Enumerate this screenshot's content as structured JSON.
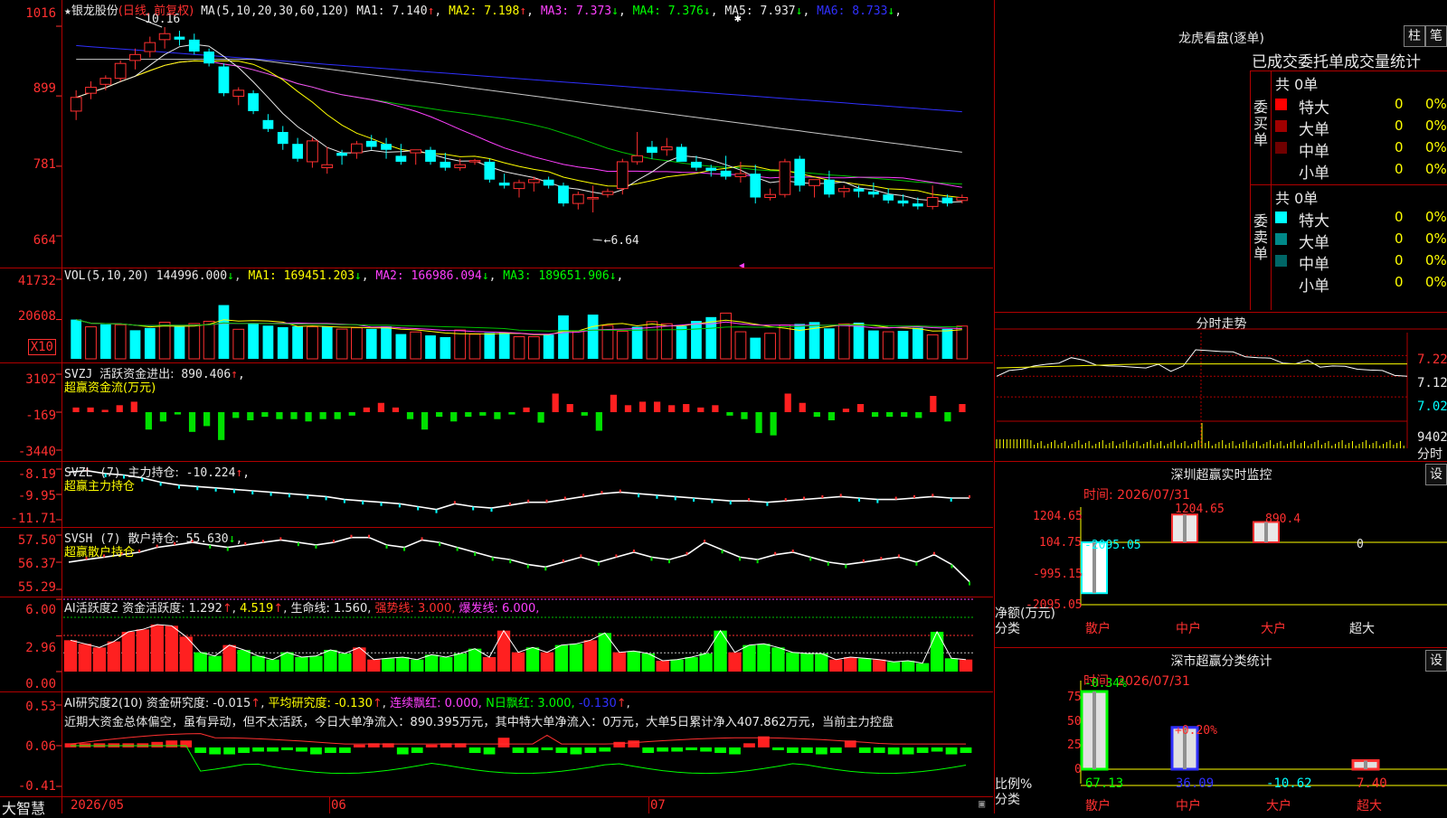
{
  "app": {
    "brand": "大智慧"
  },
  "kline": {
    "star": "★",
    "stock": "银龙股份",
    "mode": "(日线, 前复权)",
    "ma_label": "MA(5,10,20,30,60,120)",
    "ma": [
      {
        "name": "MA1:",
        "value": "7.140",
        "arrow": "↑",
        "color": "#e8e8e8"
      },
      {
        "name": "MA2:",
        "value": "7.198",
        "arrow": "↑",
        "color": "#ffff00"
      },
      {
        "name": "MA3:",
        "value": "7.373",
        "arrow": "↓",
        "color": "#ff40ff"
      },
      {
        "name": "MA4:",
        "value": "7.376",
        "arrow": "↓",
        "color": "#00ff00"
      },
      {
        "name": "MA5:",
        "value": "7.937",
        "arrow": "↓",
        "color": "#e8e8e8"
      },
      {
        "name": "MA6:",
        "value": "8.733",
        "arrow": "↓",
        "color": "#3030ff"
      }
    ],
    "yticks": [
      "1016",
      "899",
      "781",
      "664"
    ],
    "high_label": "10.16",
    "low_label": "6.64"
  },
  "volume": {
    "label": "VOL(5,10,20)",
    "value": "144996.000",
    "ma": [
      {
        "name": "MA1:",
        "value": "169451.203",
        "arrow": "↓",
        "color": "#ffff00"
      },
      {
        "name": "MA2:",
        "value": "166986.094",
        "arrow": "↓",
        "color": "#ff40ff"
      },
      {
        "name": "MA3:",
        "value": "189651.906",
        "arrow": "↓",
        "color": "#00ff00"
      }
    ],
    "yticks": [
      "41732",
      "20608"
    ],
    "unit": "X10"
  },
  "svzj": {
    "label": "SVZJ",
    "name": "活跃资金进出:",
    "value": "890.406",
    "arrow": "↑",
    "sub": "超赢资金流(万元)",
    "yticks": [
      "3102",
      "-169",
      "-3440"
    ]
  },
  "svzl": {
    "label": "SVZL (7)",
    "name": "主力持仓:",
    "value": "-10.224",
    "arrow": "↑",
    "sub": "超赢主力持仓",
    "yticks": [
      "-8.19",
      "-9.95",
      "-11.71"
    ]
  },
  "svsh": {
    "label": "SVSH (7)",
    "name": "散户持仓:",
    "value": "55.630",
    "arrow": "↓",
    "sub": "超赢散户持仓",
    "yticks": [
      "57.50",
      "56.37",
      "55.29"
    ]
  },
  "ai_active": {
    "label": "AI活跃度2",
    "name": "资金活跃度:",
    "value": "1.292",
    "v2": "4.519",
    "life": "生命线: 1.560,",
    "strong": "强势线: 3.000,",
    "burst": "爆发线: 6.000,",
    "yticks": [
      "6.00",
      "2.96",
      "0.00"
    ]
  },
  "ai_research": {
    "label": "AI研究度2(10)",
    "name": "资金研究度:",
    "value": "-0.015",
    "avg": "平均研究度: -0.130",
    "streak": "连续飘红: 0.000,",
    "nday": "N日飘红: 3.000,",
    "last": "-0.130",
    "commentary": "近期大资金总体偏空，虽有异动，但不太活跃，今日大单净流入：890.395万元，其中特大单净流入：0万元，大单5日累计净入407.862万元，当前主力控盘",
    "yticks": [
      "0.53",
      "0.06",
      "-0.41"
    ]
  },
  "xaxis": [
    "2026/05",
    "06",
    "07"
  ],
  "lhb": {
    "title": "龙虎看盘(逐单)",
    "tab1": "柱",
    "tab2": "笔",
    "headers": [
      "已成交",
      "委托单",
      "成交量统计"
    ],
    "buy_group": {
      "label": "委买单",
      "total": "共 0单"
    },
    "sell_group": {
      "label": "委卖单",
      "total": "共 0单"
    },
    "buy_rows": [
      {
        "name": "特大",
        "count": "0",
        "pct": "0%",
        "color": "#ff0000"
      },
      {
        "name": "大单",
        "count": "0",
        "pct": "0%",
        "color": "#a00000"
      },
      {
        "name": "中单",
        "count": "0",
        "pct": "0%",
        "color": "#700000"
      },
      {
        "name": "小单",
        "count": "0",
        "pct": "0%",
        "color": "#000000"
      }
    ],
    "sell_rows": [
      {
        "name": "特大",
        "count": "0",
        "pct": "0%",
        "color": "#00ffff"
      },
      {
        "name": "大单",
        "count": "0",
        "pct": "0%",
        "color": "#008888"
      },
      {
        "name": "中单",
        "count": "0",
        "pct": "0%",
        "color": "#006666"
      },
      {
        "name": "小单",
        "count": "0",
        "pct": "0%",
        "color": "#000000"
      }
    ]
  },
  "intraday": {
    "title": "分时走势",
    "yticks": [
      "7.22",
      "7.12",
      "7.02"
    ],
    "vol_label": "9402",
    "vol_unit": "分时"
  },
  "monitor": {
    "title": "深圳超赢实时监控",
    "btn": "设",
    "time": "时间: 2026/07/31",
    "yticks": [
      "1204.65",
      "104.75",
      "-995.15",
      "-2095.05"
    ],
    "ylabel": "净额(万元)",
    "xlabel": "分类",
    "categories": [
      "散户",
      "中户",
      "大户",
      "超大"
    ],
    "values": [
      -2095.05,
      1204.65,
      890.4,
      0
    ],
    "value_labels": [
      "-2095.05",
      "1204.65",
      "890.4",
      "0"
    ]
  },
  "classify": {
    "title": "深市超赢分类统计",
    "btn": "设",
    "time": "时间: 2026/07/31",
    "yticks": [
      "75",
      "50",
      "25",
      "0"
    ],
    "ylabel": "比例%",
    "xlabel": "分类",
    "categories": [
      "散户",
      "中户",
      "大户",
      "超大"
    ],
    "values": [
      67.13,
      36.09,
      -10.62,
      7.4
    ],
    "value_labels": [
      "67.13",
      "36.09",
      "-10.62",
      "7.40"
    ],
    "change_labels": [
      "-0.34%",
      "+0.20%"
    ]
  },
  "chart_data": [
    {
      "type": "candlestick",
      "title": "银龙股份 (日线, 前复权)",
      "ylim": [
        6.64,
        10.16
      ],
      "x_labels": [
        "2026/05",
        "06",
        "07"
      ],
      "candles": [
        [
          8.75,
          9.1,
          8.6,
          8.98
        ],
        [
          9.05,
          9.25,
          8.95,
          9.15
        ],
        [
          9.2,
          9.35,
          9.1,
          9.3
        ],
        [
          9.3,
          9.6,
          9.25,
          9.55
        ],
        [
          9.6,
          9.8,
          9.45,
          9.7
        ],
        [
          9.75,
          10.0,
          9.65,
          9.9
        ],
        [
          9.95,
          10.16,
          9.8,
          10.05
        ],
        [
          10.0,
          10.1,
          9.85,
          9.95
        ],
        [
          9.95,
          10.05,
          9.7,
          9.75
        ],
        [
          9.75,
          9.8,
          9.5,
          9.55
        ],
        [
          9.5,
          9.55,
          9.0,
          9.05
        ],
        [
          9.0,
          9.15,
          8.85,
          9.1
        ],
        [
          9.05,
          9.1,
          8.7,
          8.75
        ],
        [
          8.6,
          8.7,
          8.4,
          8.45
        ],
        [
          8.4,
          8.5,
          8.1,
          8.2
        ],
        [
          8.2,
          8.3,
          7.9,
          7.95
        ],
        [
          7.9,
          8.3,
          7.8,
          8.25
        ],
        [
          7.8,
          8.15,
          7.7,
          7.85
        ],
        [
          8.05,
          8.1,
          7.85,
          8.0
        ],
        [
          8.05,
          8.25,
          7.95,
          8.2
        ],
        [
          8.25,
          8.35,
          8.1,
          8.15
        ],
        [
          8.2,
          8.3,
          7.95,
          8.1
        ],
        [
          8.0,
          8.2,
          7.85,
          7.9
        ],
        [
          8.05,
          8.1,
          7.85,
          8.1
        ],
        [
          8.1,
          8.15,
          7.85,
          7.9
        ],
        [
          7.9,
          8.05,
          7.75,
          7.8
        ],
        [
          7.8,
          7.95,
          7.75,
          7.85
        ],
        [
          7.9,
          7.95,
          7.85,
          7.92
        ],
        [
          7.9,
          7.95,
          7.55,
          7.6
        ],
        [
          7.55,
          7.7,
          7.45,
          7.5
        ],
        [
          7.45,
          7.6,
          7.3,
          7.55
        ],
        [
          7.55,
          7.65,
          7.4,
          7.6
        ],
        [
          7.6,
          7.65,
          7.45,
          7.5
        ],
        [
          7.5,
          7.55,
          7.15,
          7.2
        ],
        [
          7.2,
          7.4,
          7.1,
          7.35
        ],
        [
          7.3,
          7.5,
          7.05,
          7.3
        ],
        [
          7.35,
          7.45,
          7.3,
          7.4
        ],
        [
          7.45,
          7.95,
          7.35,
          7.9
        ],
        [
          7.9,
          8.4,
          7.85,
          8.0
        ],
        [
          8.15,
          8.25,
          7.95,
          8.05
        ],
        [
          8.1,
          8.3,
          8.0,
          8.15
        ],
        [
          8.15,
          8.2,
          7.95,
          7.9
        ],
        [
          7.9,
          8.0,
          7.75,
          7.8
        ],
        [
          7.8,
          7.85,
          7.65,
          7.75
        ],
        [
          7.75,
          8.0,
          7.6,
          7.65
        ],
        [
          7.65,
          7.9,
          7.55,
          7.7
        ],
        [
          7.7,
          7.85,
          7.2,
          7.3
        ],
        [
          7.3,
          7.45,
          7.25,
          7.35
        ],
        [
          7.35,
          7.95,
          7.3,
          7.9
        ],
        [
          7.95,
          8.0,
          7.4,
          7.5
        ],
        [
          7.5,
          7.55,
          7.3,
          7.6
        ],
        [
          7.6,
          7.75,
          7.3,
          7.35
        ],
        [
          7.4,
          7.5,
          7.3,
          7.45
        ],
        [
          7.45,
          7.5,
          7.3,
          7.4
        ],
        [
          7.4,
          7.55,
          7.3,
          7.35
        ],
        [
          7.35,
          7.45,
          7.2,
          7.25
        ],
        [
          7.25,
          7.35,
          7.15,
          7.2
        ],
        [
          7.2,
          7.3,
          7.1,
          7.15
        ],
        [
          7.15,
          7.5,
          7.1,
          7.3
        ],
        [
          7.3,
          7.35,
          7.15,
          7.2
        ],
        [
          7.25,
          7.35,
          7.2,
          7.3
        ]
      ]
    },
    {
      "type": "bar",
      "title": "VOL(5,10,20)",
      "ylim": [
        0,
        41732
      ],
      "values": [
        20600,
        16800,
        18100,
        17900,
        15000,
        16200,
        19200,
        17000,
        18500,
        19700,
        28200,
        15500,
        18500,
        17400,
        16600,
        17100,
        16800,
        16900,
        15600,
        16300,
        15700,
        17000,
        13000,
        14100,
        12300,
        11400,
        15100,
        12900,
        13600,
        13700,
        11600,
        11600,
        12700,
        22800,
        14600,
        23200,
        17500,
        14500,
        16800,
        19500,
        18400,
        17200,
        19900,
        21900,
        24000,
        14200,
        11100,
        13400,
        17700,
        18300,
        19300,
        16000,
        18300,
        19000,
        14900,
        14200,
        14700,
        16300,
        12600,
        15700,
        17200
      ],
      "up": [
        false,
        true,
        false,
        true,
        false,
        false,
        true,
        false,
        true,
        true,
        false,
        true,
        false,
        false,
        false,
        false,
        true,
        false,
        true,
        true,
        false,
        false,
        false,
        true,
        false,
        false,
        true,
        true,
        false,
        false,
        true,
        true,
        false,
        false,
        true,
        false,
        true,
        true,
        false,
        true,
        true,
        false,
        false,
        false,
        true,
        true,
        false,
        true,
        true,
        false,
        false,
        false,
        true,
        false,
        false,
        true,
        false,
        false,
        true,
        false,
        true
      ]
    },
    {
      "type": "bar",
      "title": "SVZJ 活跃资金进出",
      "ylim": [
        -3440,
        3102
      ],
      "values": [
        400,
        400,
        200,
        600,
        900,
        -1500,
        -800,
        -200,
        -1700,
        -1200,
        -2400,
        -500,
        -700,
        -400,
        -600,
        -600,
        -800,
        -600,
        -600,
        -300,
        400,
        800,
        400,
        -600,
        -1500,
        -400,
        -800,
        -400,
        -300,
        -600,
        -200,
        400,
        -900,
        1600,
        700,
        -300,
        -1600,
        1500,
        600,
        900,
        900,
        600,
        700,
        400,
        600,
        -300,
        -600,
        -1800,
        -2000,
        1600,
        800,
        -400,
        -700,
        300,
        700,
        -400,
        -400,
        -400,
        -500,
        1400,
        -800,
        700
      ]
    },
    {
      "type": "line",
      "title": "SVZL 主力持仓",
      "ylim": [
        -11.71,
        -8.19
      ],
      "values": [
        -8.4,
        -8.3,
        -8.5,
        -8.6,
        -8.8,
        -9.1,
        -9.3,
        -9.4,
        -9.5,
        -9.6,
        -9.7,
        -9.8,
        -9.9,
        -10.0,
        -10.1,
        -10.3,
        -10.4,
        -10.5,
        -10.6,
        -10.8,
        -11.0,
        -10.6,
        -10.8,
        -10.9,
        -10.7,
        -10.5,
        -10.5,
        -10.3,
        -10.1,
        -9.9,
        -9.8,
        -9.9,
        -10.0,
        -10.1,
        -10.2,
        -10.3,
        -10.4,
        -10.4,
        -10.5,
        -10.4,
        -10.3,
        -10.2,
        -10.1,
        -10.2,
        -10.3,
        -10.3,
        -10.2,
        -10.1,
        -10.2,
        -10.2
      ]
    },
    {
      "type": "line",
      "title": "SVSH 散户持仓",
      "ylim": [
        55.29,
        57.5
      ],
      "values": [
        56.4,
        56.5,
        56.6,
        56.7,
        56.8,
        57.0,
        57.1,
        57.2,
        57.1,
        57.0,
        57.1,
        57.2,
        57.3,
        57.2,
        57.1,
        57.2,
        57.4,
        57.4,
        57.1,
        57.0,
        57.3,
        57.2,
        57.0,
        56.8,
        56.6,
        56.5,
        56.3,
        56.2,
        56.4,
        56.6,
        56.4,
        56.6,
        56.8,
        56.6,
        56.5,
        56.7,
        57.2,
        56.9,
        56.6,
        56.5,
        56.7,
        56.8,
        56.6,
        56.4,
        56.3,
        56.4,
        56.5,
        56.6,
        56.4,
        56.7,
        56.3,
        55.6
      ]
    },
    {
      "type": "bar",
      "title": "AI活跃度2 资金活跃度",
      "ylim": [
        0,
        6
      ],
      "values": [
        2.6,
        2.3,
        2.0,
        2.5,
        3.3,
        3.5,
        3.9,
        3.8,
        2.9,
        1.6,
        1.3,
        2.2,
        1.8,
        1.3,
        1.0,
        1.6,
        1.2,
        1.3,
        1.8,
        1.5,
        2.0,
        1.0,
        1.1,
        1.2,
        1.0,
        1.4,
        1.2,
        1.5,
        1.9,
        1.2,
        3.4,
        1.6,
        2.0,
        1.6,
        2.2,
        2.3,
        2.6,
        3.2,
        1.6,
        1.7,
        1.5,
        0.9,
        1.0,
        1.2,
        1.5,
        3.4,
        1.6,
        2.2,
        2.3,
        2.0,
        1.6,
        1.5,
        1.5,
        1.0,
        1.2,
        1.1,
        1.0,
        0.8,
        0.9,
        0.7,
        3.3,
        1.1,
        1.0
      ],
      "red": [
        true,
        true,
        true,
        true,
        true,
        true,
        true,
        true,
        true,
        false,
        false,
        true,
        false,
        false,
        false,
        false,
        false,
        false,
        false,
        false,
        true,
        true,
        false,
        false,
        false,
        false,
        false,
        false,
        false,
        true,
        true,
        true,
        false,
        true,
        false,
        false,
        true,
        false,
        true,
        false,
        false,
        true,
        false,
        false,
        false,
        false,
        true,
        false,
        false,
        false,
        false,
        false,
        false,
        true,
        true,
        false,
        true,
        false,
        false,
        false,
        false,
        false,
        true,
        false,
        false
      ]
    },
    {
      "type": "bar",
      "title": "AI研究度2(10) 资金研究度",
      "ylim": [
        -0.41,
        0.53
      ],
      "values": [
        0.03,
        0.03,
        0.03,
        0.03,
        0.03,
        0.03,
        0.04,
        0.05,
        0.05,
        -0.04,
        -0.05,
        -0.05,
        -0.04,
        -0.03,
        -0.03,
        -0.02,
        -0.03,
        -0.05,
        -0.04,
        -0.04,
        0.02,
        0.03,
        0.03,
        -0.05,
        -0.04,
        0.02,
        0.03,
        0.03,
        -0.04,
        -0.05,
        0.07,
        -0.04,
        -0.04,
        -0.02,
        -0.04,
        -0.05,
        -0.04,
        -0.03,
        0.04,
        0.05,
        -0.04,
        -0.03,
        -0.03,
        -0.02,
        -0.03,
        -0.04,
        -0.05,
        0.03,
        0.08,
        -0.02,
        -0.04,
        -0.04,
        -0.05,
        -0.04,
        0.05,
        -0.04,
        -0.04,
        -0.05,
        -0.05,
        -0.04,
        -0.03,
        -0.05,
        -0.04
      ]
    },
    {
      "type": "line",
      "title": "分时走势",
      "ylim": [
        7.02,
        7.22
      ],
      "values": [
        7.12,
        7.14,
        7.16,
        7.17,
        7.17,
        7.19,
        7.21,
        7.19,
        7.18,
        7.17,
        7.16,
        7.17,
        7.16,
        7.17,
        7.15,
        7.17,
        7.24,
        7.25,
        7.24,
        7.23,
        7.22,
        7.21,
        7.2,
        7.19,
        7.18,
        7.19,
        7.17,
        7.17,
        7.16,
        7.16,
        7.15,
        7.14,
        7.13,
        7.12
      ]
    },
    {
      "type": "bar",
      "title": "深圳超赢实时监控",
      "categories": [
        "散户",
        "中户",
        "大户",
        "超大"
      ],
      "values": [
        -2095.05,
        1204.65,
        890.4,
        0
      ],
      "ylim": [
        -2095.05,
        1204.65
      ],
      "ylabel": "净额(万元)",
      "xlabel": "分类"
    },
    {
      "type": "bar",
      "title": "深市超赢分类统计",
      "categories": [
        "散户",
        "中户",
        "大户",
        "超大"
      ],
      "values": [
        67.13,
        36.09,
        -10.62,
        7.4
      ],
      "ylim": [
        0,
        75
      ],
      "ylabel": "比例%",
      "xlabel": "分类"
    }
  ]
}
